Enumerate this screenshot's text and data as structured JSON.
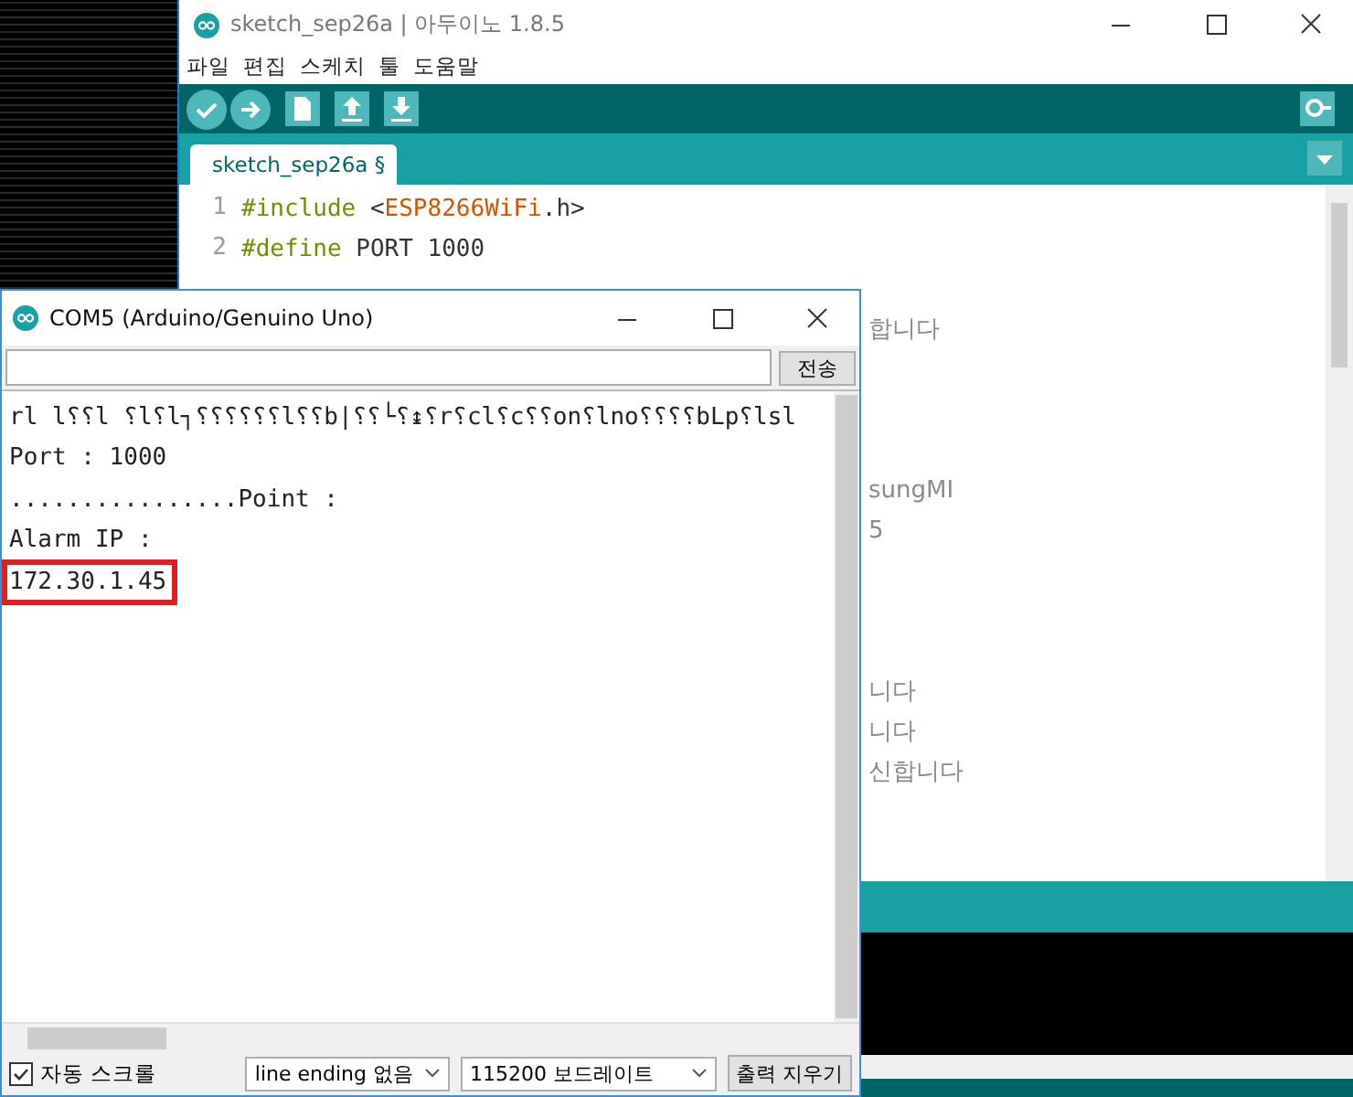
{
  "ide": {
    "title": "sketch_sep26a | 아두이노 1.8.5",
    "menu": [
      "파일",
      "편집",
      "스케치",
      "툴",
      "도움말"
    ],
    "toolbar": [
      {
        "kind": "verify"
      },
      {
        "kind": "upload"
      },
      {
        "kind": "new"
      },
      {
        "kind": "open"
      },
      {
        "kind": "save"
      }
    ],
    "tab": {
      "label": "sketch_sep26a §",
      "selected": true
    },
    "code_lines": [
      {
        "number": "1",
        "tokens": [
          {
            "kind": "keyword",
            "text": "#include"
          },
          {
            "kind": "plain",
            "text": " <"
          },
          {
            "kind": "library",
            "text": "ESP8266WiFi"
          },
          {
            "kind": "plain",
            "text": ".h>"
          }
        ]
      },
      {
        "number": "2",
        "tokens": [
          {
            "kind": "keyword",
            "text": "#define"
          },
          {
            "kind": "plain",
            "text": " PORT 1000"
          }
        ]
      },
      {
        "tokens": [
          {
            "kind": "comment",
            "text": "합니다"
          }
        ]
      },
      {
        "tokens": [
          {
            "kind": "comment",
            "text": "sungMI"
          }
        ]
      },
      {
        "tokens": [
          {
            "kind": "comment",
            "text": "5"
          }
        ]
      },
      {
        "tokens": [
          {
            "kind": "comment",
            "text": "니다"
          }
        ]
      },
      {
        "tokens": [
          {
            "kind": "comment",
            "text": "니다"
          }
        ]
      },
      {
        "tokens": [
          {
            "kind": "comment",
            "text": "신합니다"
          }
        ]
      }
    ]
  },
  "serial_monitor": {
    "title": "COM5 (Arduino/Genuino Uno)",
    "send_button": "전송",
    "output": [
      {
        "text": "rl l⸮⸮l ⸮l⸮l┐⸮⸮⸮⸮⸮⸮l⸮⸮b|⸮⸮└⸮↨⸮r⸮cl⸮c⸮⸮on⸮lno⸮⸮⸮⸮bLp⸮lsl",
        "highlighted": false
      },
      {
        "text": "Port : 1000",
        "highlighted": false
      },
      {
        "text": "................Point :",
        "highlighted": false
      },
      {
        "text": "Alarm IP :",
        "highlighted": false
      },
      {
        "text": "172.30.1.45",
        "highlighted": true
      }
    ],
    "autoscroll": {
      "label": "자동 스크롤",
      "checked": true
    },
    "line_ending": "line ending 없음",
    "baud_rate": "115200 보드레이트",
    "clear_button": "출력 지우기"
  }
}
